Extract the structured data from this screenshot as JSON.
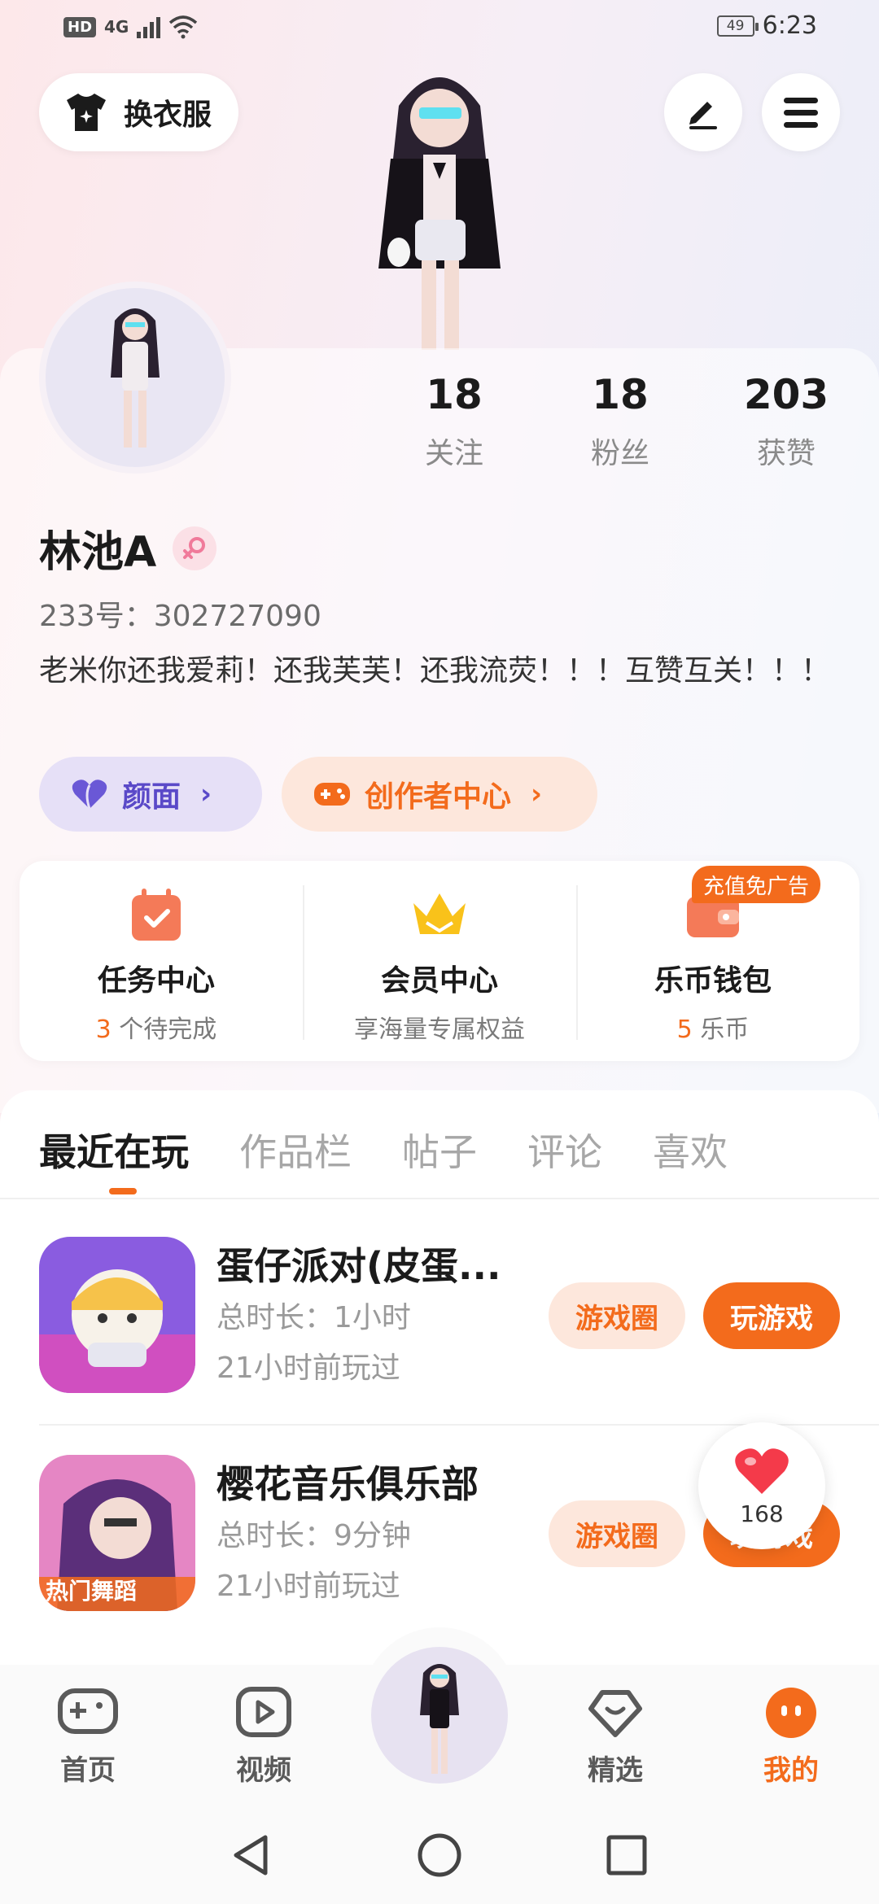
{
  "status_bar": {
    "hd": "HD",
    "signal": "4G",
    "battery": "49",
    "time": "6:23"
  },
  "header": {
    "outfit_label": "换衣服",
    "edit_icon": "edit-icon",
    "menu_icon": "menu-icon"
  },
  "profile": {
    "stats": [
      {
        "num": "18",
        "label": "关注"
      },
      {
        "num": "18",
        "label": "粉丝"
      },
      {
        "num": "203",
        "label": "获赞"
      }
    ],
    "name": "林池A",
    "gender": "female",
    "uid": "233号：302727090",
    "bio": "老米你还我爱莉！还我芙芙！还我流荧！！！互赞互关！！！",
    "face_label": "颜面",
    "creator_label": "创作者中心"
  },
  "services": {
    "ad_tag": "充值免广告",
    "items": [
      {
        "title": "任务中心",
        "highlight": "3",
        "sub": " 个待完成"
      },
      {
        "title": "会员中心",
        "highlight": "",
        "sub": "享海量专属权益"
      },
      {
        "title": "乐币钱包",
        "highlight": "5",
        "sub": " 乐币"
      }
    ]
  },
  "tabs": [
    "最近在玩",
    "作品栏",
    "帖子",
    "评论",
    "喜欢"
  ],
  "games": [
    {
      "name": "蛋仔派对(皮蛋...",
      "duration": "总时长：1小时",
      "last_played": "21小时前玩过",
      "circle_label": "游戏圈",
      "play_label": "玩游戏"
    },
    {
      "name": "樱花音乐俱乐部",
      "duration": "总时长：9分钟",
      "last_played": "21小时前玩过",
      "circle_label": "游戏圈",
      "play_label": "玩游戏",
      "icon_text": "热门舞蹈"
    }
  ],
  "floating_like": {
    "count": "168"
  },
  "bottom_nav": [
    {
      "label": "首页",
      "active": false
    },
    {
      "label": "视频",
      "active": false
    },
    {
      "label": "精选",
      "active": false
    },
    {
      "label": "我的",
      "active": true
    }
  ],
  "colors": {
    "accent": "#f36b1c",
    "purple": "#5a49c8"
  }
}
